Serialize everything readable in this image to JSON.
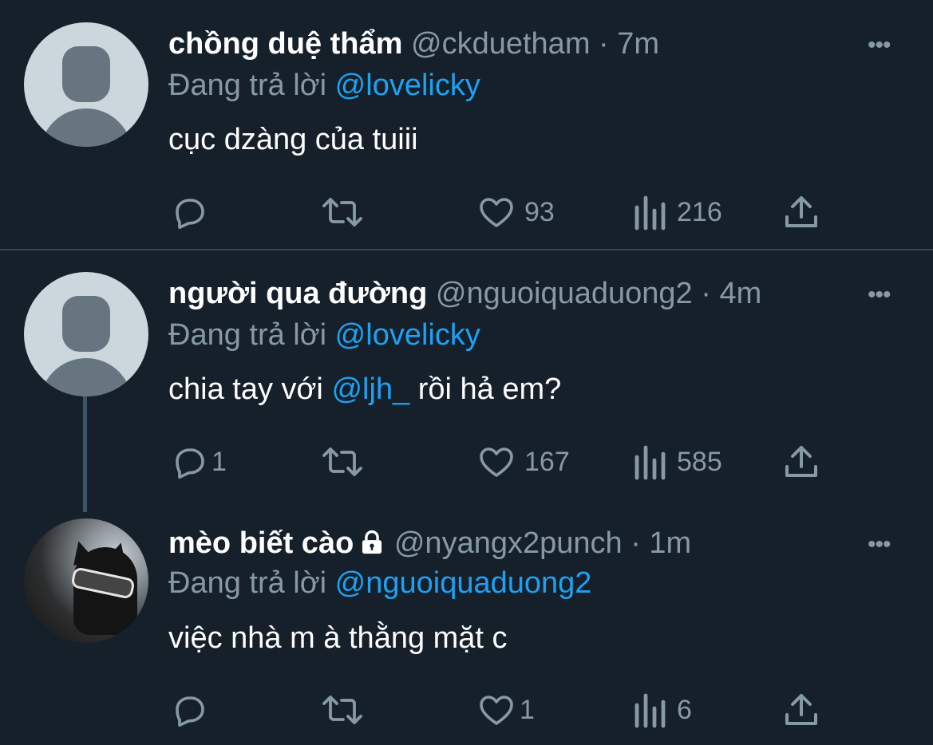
{
  "tweets": [
    {
      "name": "chồng duệ thẩm",
      "handle": "@ckduetham",
      "dot": " · ",
      "time": "7m",
      "reply_prefix": "Đang trả lời ",
      "reply_to": "@lovelicky",
      "text_before": "cục dzàng của tuiii",
      "mention": "",
      "text_after": "",
      "replies": "",
      "likes": "93",
      "views": "216",
      "protected": false
    },
    {
      "name": "người qua đường",
      "handle": "@nguoiquaduong2",
      "dot": " · ",
      "time": "4m",
      "reply_prefix": "Đang trả lời ",
      "reply_to": "@lovelicky",
      "text_before": "chia tay với ",
      "mention": "@ljh_",
      "text_after": " rồi hả em?",
      "replies": "1",
      "likes": "167",
      "views": "585",
      "protected": false
    },
    {
      "name": "mèo biết cào",
      "handle": "@nyangx2punch",
      "dot": " · ",
      "time": "1m",
      "reply_prefix": "Đang trả lời ",
      "reply_to": "@nguoiquaduong2",
      "text_before": "việc nhà m à thằng mặt c",
      "mention": "",
      "text_after": "",
      "replies": "",
      "likes": "1",
      "views": "6",
      "protected": true
    }
  ],
  "more_glyph": "•••",
  "icons": {
    "reply": "reply-icon",
    "retweet": "retweet-icon",
    "like": "heart-icon",
    "views": "views-icon",
    "share": "share-icon",
    "more": "more-icon",
    "lock": "lock-icon"
  },
  "colors": {
    "background": "#15202b",
    "muted": "#8899a6",
    "accent": "#1da1f2",
    "divider": "#38444d"
  }
}
